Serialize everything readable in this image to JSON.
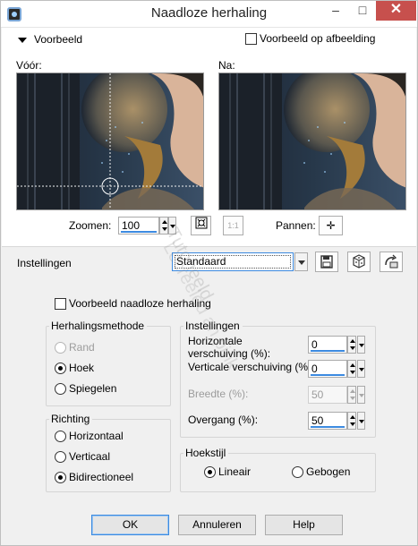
{
  "window": {
    "title": "Naadloze herhaling",
    "minimize_glyph": "–",
    "maximize_glyph": "□",
    "close_glyph": "✕"
  },
  "preview": {
    "section_label": "Voorbeeld",
    "preview_on_image_label": "Voorbeeld op afbeelding",
    "before_label": "Vóór:",
    "after_label": "Na:",
    "zoom_label": "Zoomen:",
    "zoom_value": "100",
    "pan_label": "Pannen:",
    "actual_size_glyph": "1:1",
    "pan_glyph": "✛"
  },
  "settings_bar": {
    "label": "Instellingen",
    "preset_value": "Standaard"
  },
  "options": {
    "seamless_preview_label": "Voorbeeld naadloze herhaling",
    "method_group": {
      "title": "Herhalingsmethode",
      "options": [
        "Rand",
        "Hoek",
        "Spiegelen"
      ],
      "selected": "Hoek"
    },
    "direction_group": {
      "title": "Richting",
      "options": [
        "Horizontaal",
        "Verticaal",
        "Bidirectioneel"
      ],
      "selected": "Bidirectioneel"
    },
    "settings_group": {
      "title": "Instellingen",
      "horizontal_offset_label": "Horizontale verschuiving (%):",
      "horizontal_offset_value": "0",
      "vertical_offset_label": "Verticale verschuiving (%):",
      "vertical_offset_value": "0",
      "width_label": "Breedte (%):",
      "width_value": "50",
      "transition_label": "Overgang (%):",
      "transition_value": "50"
    },
    "corner_group": {
      "title": "Hoekstijl",
      "options": [
        "Lineair",
        "Gebogen"
      ],
      "selected": "Lineair"
    }
  },
  "buttons": {
    "ok": "OK",
    "cancel": "Annuleren",
    "help": "Help"
  },
  "watermark": {
    "line1": "Tutorieeld",
    "line2": "Lecreeled an pink"
  },
  "colors": {
    "accent": "#3c8ae0",
    "close_button": "#c7504d",
    "panel_bg": "#f0f0f0"
  }
}
